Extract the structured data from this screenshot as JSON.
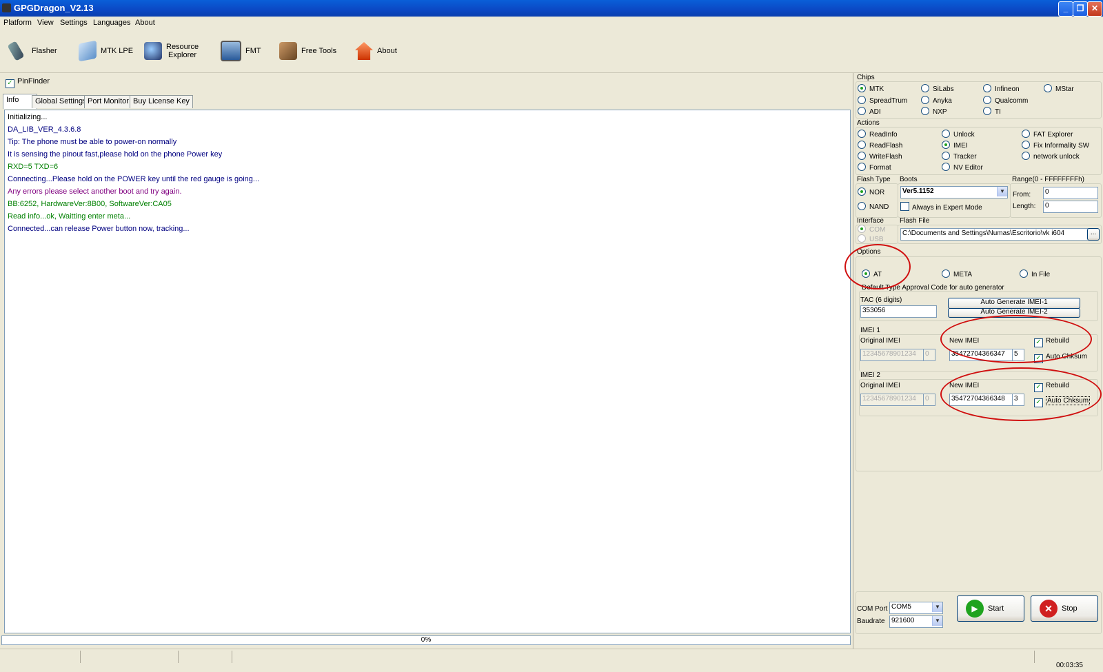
{
  "window": {
    "title": "GPGDragon_V2.13"
  },
  "menu": [
    "Platform",
    "View",
    "Settings",
    "Languages",
    "About"
  ],
  "toolbar": {
    "flasher": "Flasher",
    "mtk_lpe": "MTK LPE",
    "resource_explorer_1": "Resource",
    "resource_explorer_2": "Explorer",
    "fmt": "FMT",
    "free_tools": "Free Tools",
    "about": "About"
  },
  "pinfinder": {
    "label": "PinFinder",
    "checked": true
  },
  "tabs": [
    "Info",
    "Global Settings",
    "Port Monitor",
    "Buy License Key"
  ],
  "log": [
    {
      "text": "Initializing...",
      "color": "#000000"
    },
    {
      "text": "DA_LIB_VER_4.3.6.8",
      "color": "#000080"
    },
    {
      "text": "Tip: The phone must be able to power-on normally",
      "color": "#000080"
    },
    {
      "text": "It is sensing the pinout fast,please hold on the phone Power key",
      "color": "#000080"
    },
    {
      "text": "RXD=5  TXD=6",
      "color": "#008000"
    },
    {
      "text": "Connecting...Please hold on the POWER key until the red gauge is going...",
      "color": "#000080"
    },
    {
      "text": "Any errors please select another boot and try again.",
      "color": "#800080"
    },
    {
      "text": "BB:6252,     HardwareVer:8B00,     SoftwareVer:CA05",
      "color": "#008000"
    },
    {
      "text": "Read info...ok, Waitting enter meta...",
      "color": "#008000"
    },
    {
      "text": "Connected...can release Power button now, tracking...",
      "color": "#000080"
    }
  ],
  "progress": {
    "label": "0%",
    "value": 0
  },
  "status": {
    "time": "00:03:35"
  },
  "chips": {
    "title": "Chips",
    "items": [
      "MTK",
      "SiLabs",
      "Infineon",
      "MStar",
      "SpreadTrum",
      "Anyka",
      "Qualcomm",
      "ADI",
      "NXP",
      "TI"
    ],
    "selected": "MTK"
  },
  "actions": {
    "title": "Actions",
    "items": [
      "ReadInfo",
      "Unlock",
      "FAT Explorer",
      "ReadFlash",
      "IMEI",
      "Fix Informality SW",
      "WriteFlash",
      "Tracker",
      "network unlock",
      "Format",
      "NV Editor"
    ],
    "selected": "IMEI"
  },
  "flash_type": {
    "title": "Flash Type",
    "nor": "NOR",
    "nand": "NAND",
    "selected": "NOR"
  },
  "boots": {
    "title": "Boots",
    "value": "Ver5.1152",
    "expert_label": "Always in Expert Mode"
  },
  "range": {
    "title": "Range(0 - FFFFFFFFh)",
    "from_label": "From:",
    "from_value": "0",
    "length_label": "Length:",
    "length_value": "0"
  },
  "interface": {
    "title": "Interface",
    "com": "COM",
    "usb": "USB"
  },
  "flash_file": {
    "title": "Flash File",
    "value": "C:\\Documents and Settings\\Numas\\Escritorio\\vk i604",
    "browse": "..."
  },
  "options": {
    "title": "Options",
    "at": "AT",
    "meta": "META",
    "in_file": "In File",
    "selected": "AT"
  },
  "tac": {
    "section_title": "Default Type Approval Code for auto generator",
    "label": "TAC (6 digits)",
    "value": "353056",
    "btn_imei1": "Auto Generate IMEI-1",
    "btn_imei2": "Auto Generate IMEI-2"
  },
  "imei1": {
    "title": "IMEI 1",
    "original_label": "Original IMEI",
    "original_value": "12345678901234",
    "original_check": "0",
    "new_label": "New IMEI",
    "new_value": "35472704366347",
    "new_check": "5",
    "rebuild": "Rebuild",
    "auto_chksum": "Auto Chksum"
  },
  "imei2": {
    "title": "IMEI 2",
    "original_label": "Original IMEI",
    "original_value": "12345678901234",
    "original_check": "0",
    "new_label": "New IMEI",
    "new_value": "35472704366348",
    "new_check": "3",
    "rebuild": "Rebuild",
    "auto_chksum": "Auto Chksum"
  },
  "port": {
    "com_label": "COM Port",
    "com_value": "COM5",
    "baud_label": "Baudrate",
    "baud_value": "921600"
  },
  "buttons": {
    "start": "Start",
    "stop": "Stop"
  },
  "colors": {
    "titlebar": "#0b48c4",
    "start": "#1fa31f",
    "stop": "#d02020",
    "annotation": "#d01010"
  }
}
